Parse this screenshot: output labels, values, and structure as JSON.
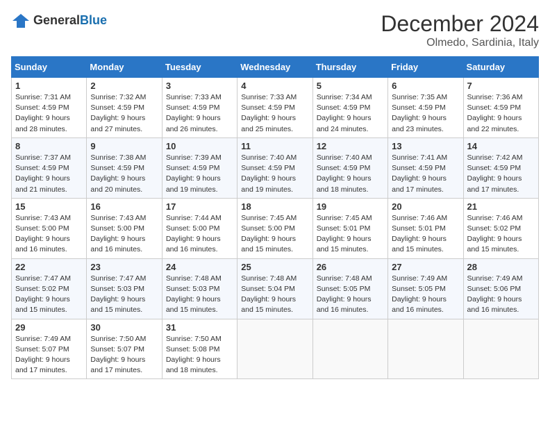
{
  "header": {
    "logo_general": "General",
    "logo_blue": "Blue",
    "month": "December 2024",
    "location": "Olmedo, Sardinia, Italy"
  },
  "weekdays": [
    "Sunday",
    "Monday",
    "Tuesday",
    "Wednesday",
    "Thursday",
    "Friday",
    "Saturday"
  ],
  "weeks": [
    [
      {
        "day": 1,
        "sunrise": "7:31 AM",
        "sunset": "4:59 PM",
        "daylight": "9 hours and 28 minutes."
      },
      {
        "day": 2,
        "sunrise": "7:32 AM",
        "sunset": "4:59 PM",
        "daylight": "9 hours and 27 minutes."
      },
      {
        "day": 3,
        "sunrise": "7:33 AM",
        "sunset": "4:59 PM",
        "daylight": "9 hours and 26 minutes."
      },
      {
        "day": 4,
        "sunrise": "7:33 AM",
        "sunset": "4:59 PM",
        "daylight": "9 hours and 25 minutes."
      },
      {
        "day": 5,
        "sunrise": "7:34 AM",
        "sunset": "4:59 PM",
        "daylight": "9 hours and 24 minutes."
      },
      {
        "day": 6,
        "sunrise": "7:35 AM",
        "sunset": "4:59 PM",
        "daylight": "9 hours and 23 minutes."
      },
      {
        "day": 7,
        "sunrise": "7:36 AM",
        "sunset": "4:59 PM",
        "daylight": "9 hours and 22 minutes."
      }
    ],
    [
      {
        "day": 8,
        "sunrise": "7:37 AM",
        "sunset": "4:59 PM",
        "daylight": "9 hours and 21 minutes."
      },
      {
        "day": 9,
        "sunrise": "7:38 AM",
        "sunset": "4:59 PM",
        "daylight": "9 hours and 20 minutes."
      },
      {
        "day": 10,
        "sunrise": "7:39 AM",
        "sunset": "4:59 PM",
        "daylight": "9 hours and 19 minutes."
      },
      {
        "day": 11,
        "sunrise": "7:40 AM",
        "sunset": "4:59 PM",
        "daylight": "9 hours and 19 minutes."
      },
      {
        "day": 12,
        "sunrise": "7:40 AM",
        "sunset": "4:59 PM",
        "daylight": "9 hours and 18 minutes."
      },
      {
        "day": 13,
        "sunrise": "7:41 AM",
        "sunset": "4:59 PM",
        "daylight": "9 hours and 17 minutes."
      },
      {
        "day": 14,
        "sunrise": "7:42 AM",
        "sunset": "4:59 PM",
        "daylight": "9 hours and 17 minutes."
      }
    ],
    [
      {
        "day": 15,
        "sunrise": "7:43 AM",
        "sunset": "5:00 PM",
        "daylight": "9 hours and 16 minutes."
      },
      {
        "day": 16,
        "sunrise": "7:43 AM",
        "sunset": "5:00 PM",
        "daylight": "9 hours and 16 minutes."
      },
      {
        "day": 17,
        "sunrise": "7:44 AM",
        "sunset": "5:00 PM",
        "daylight": "9 hours and 16 minutes."
      },
      {
        "day": 18,
        "sunrise": "7:45 AM",
        "sunset": "5:00 PM",
        "daylight": "9 hours and 15 minutes."
      },
      {
        "day": 19,
        "sunrise": "7:45 AM",
        "sunset": "5:01 PM",
        "daylight": "9 hours and 15 minutes."
      },
      {
        "day": 20,
        "sunrise": "7:46 AM",
        "sunset": "5:01 PM",
        "daylight": "9 hours and 15 minutes."
      },
      {
        "day": 21,
        "sunrise": "7:46 AM",
        "sunset": "5:02 PM",
        "daylight": "9 hours and 15 minutes."
      }
    ],
    [
      {
        "day": 22,
        "sunrise": "7:47 AM",
        "sunset": "5:02 PM",
        "daylight": "9 hours and 15 minutes."
      },
      {
        "day": 23,
        "sunrise": "7:47 AM",
        "sunset": "5:03 PM",
        "daylight": "9 hours and 15 minutes."
      },
      {
        "day": 24,
        "sunrise": "7:48 AM",
        "sunset": "5:03 PM",
        "daylight": "9 hours and 15 minutes."
      },
      {
        "day": 25,
        "sunrise": "7:48 AM",
        "sunset": "5:04 PM",
        "daylight": "9 hours and 15 minutes."
      },
      {
        "day": 26,
        "sunrise": "7:48 AM",
        "sunset": "5:05 PM",
        "daylight": "9 hours and 16 minutes."
      },
      {
        "day": 27,
        "sunrise": "7:49 AM",
        "sunset": "5:05 PM",
        "daylight": "9 hours and 16 minutes."
      },
      {
        "day": 28,
        "sunrise": "7:49 AM",
        "sunset": "5:06 PM",
        "daylight": "9 hours and 16 minutes."
      }
    ],
    [
      {
        "day": 29,
        "sunrise": "7:49 AM",
        "sunset": "5:07 PM",
        "daylight": "9 hours and 17 minutes."
      },
      {
        "day": 30,
        "sunrise": "7:50 AM",
        "sunset": "5:07 PM",
        "daylight": "9 hours and 17 minutes."
      },
      {
        "day": 31,
        "sunrise": "7:50 AM",
        "sunset": "5:08 PM",
        "daylight": "9 hours and 18 minutes."
      },
      null,
      null,
      null,
      null
    ]
  ]
}
